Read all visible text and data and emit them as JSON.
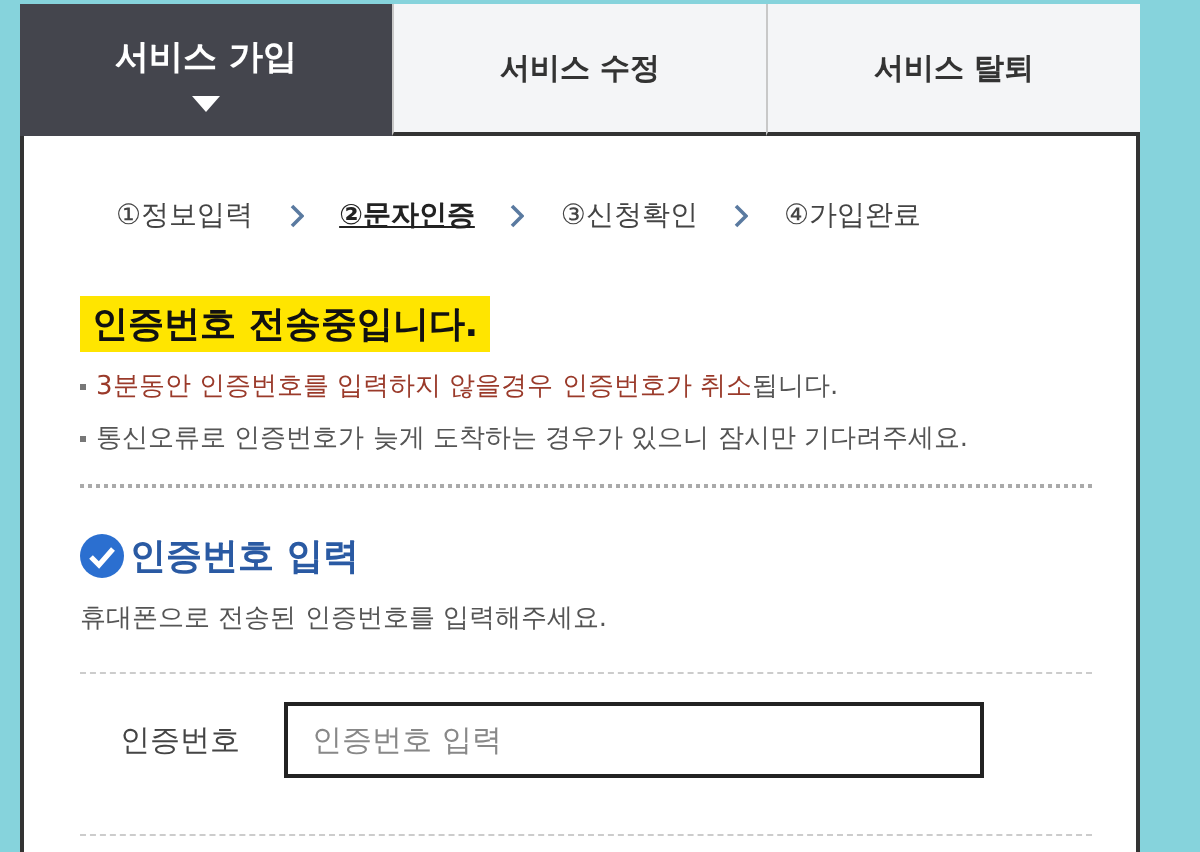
{
  "tabs": [
    {
      "label": "서비스 가입",
      "selected": true
    },
    {
      "label": "서비스 수정",
      "selected": false
    },
    {
      "label": "서비스 탈퇴",
      "selected": false
    }
  ],
  "steps": [
    {
      "label": "①정보입력",
      "selected": false
    },
    {
      "label": "②문자인증",
      "selected": true
    },
    {
      "label": "③신청확인",
      "selected": false
    },
    {
      "label": "④가입완료",
      "selected": false
    }
  ],
  "status_heading": "인증번호 전송중입니다.",
  "notices": [
    {
      "highlighted": "3분동안 인증번호를 입력하지 않을경우 인증번호가 취소",
      "rest": "됩니다."
    },
    {
      "rest": "통신오류로 인증번호가 늦게 도착하는 경우가 있으니 잠시만 기다려주세요."
    }
  ],
  "section": {
    "title": "인증번호 입력",
    "description": "휴대폰으로 전송된 인증번호를 입력해주세요."
  },
  "field": {
    "label": "인증번호",
    "placeholder": "인증번호 입력"
  }
}
